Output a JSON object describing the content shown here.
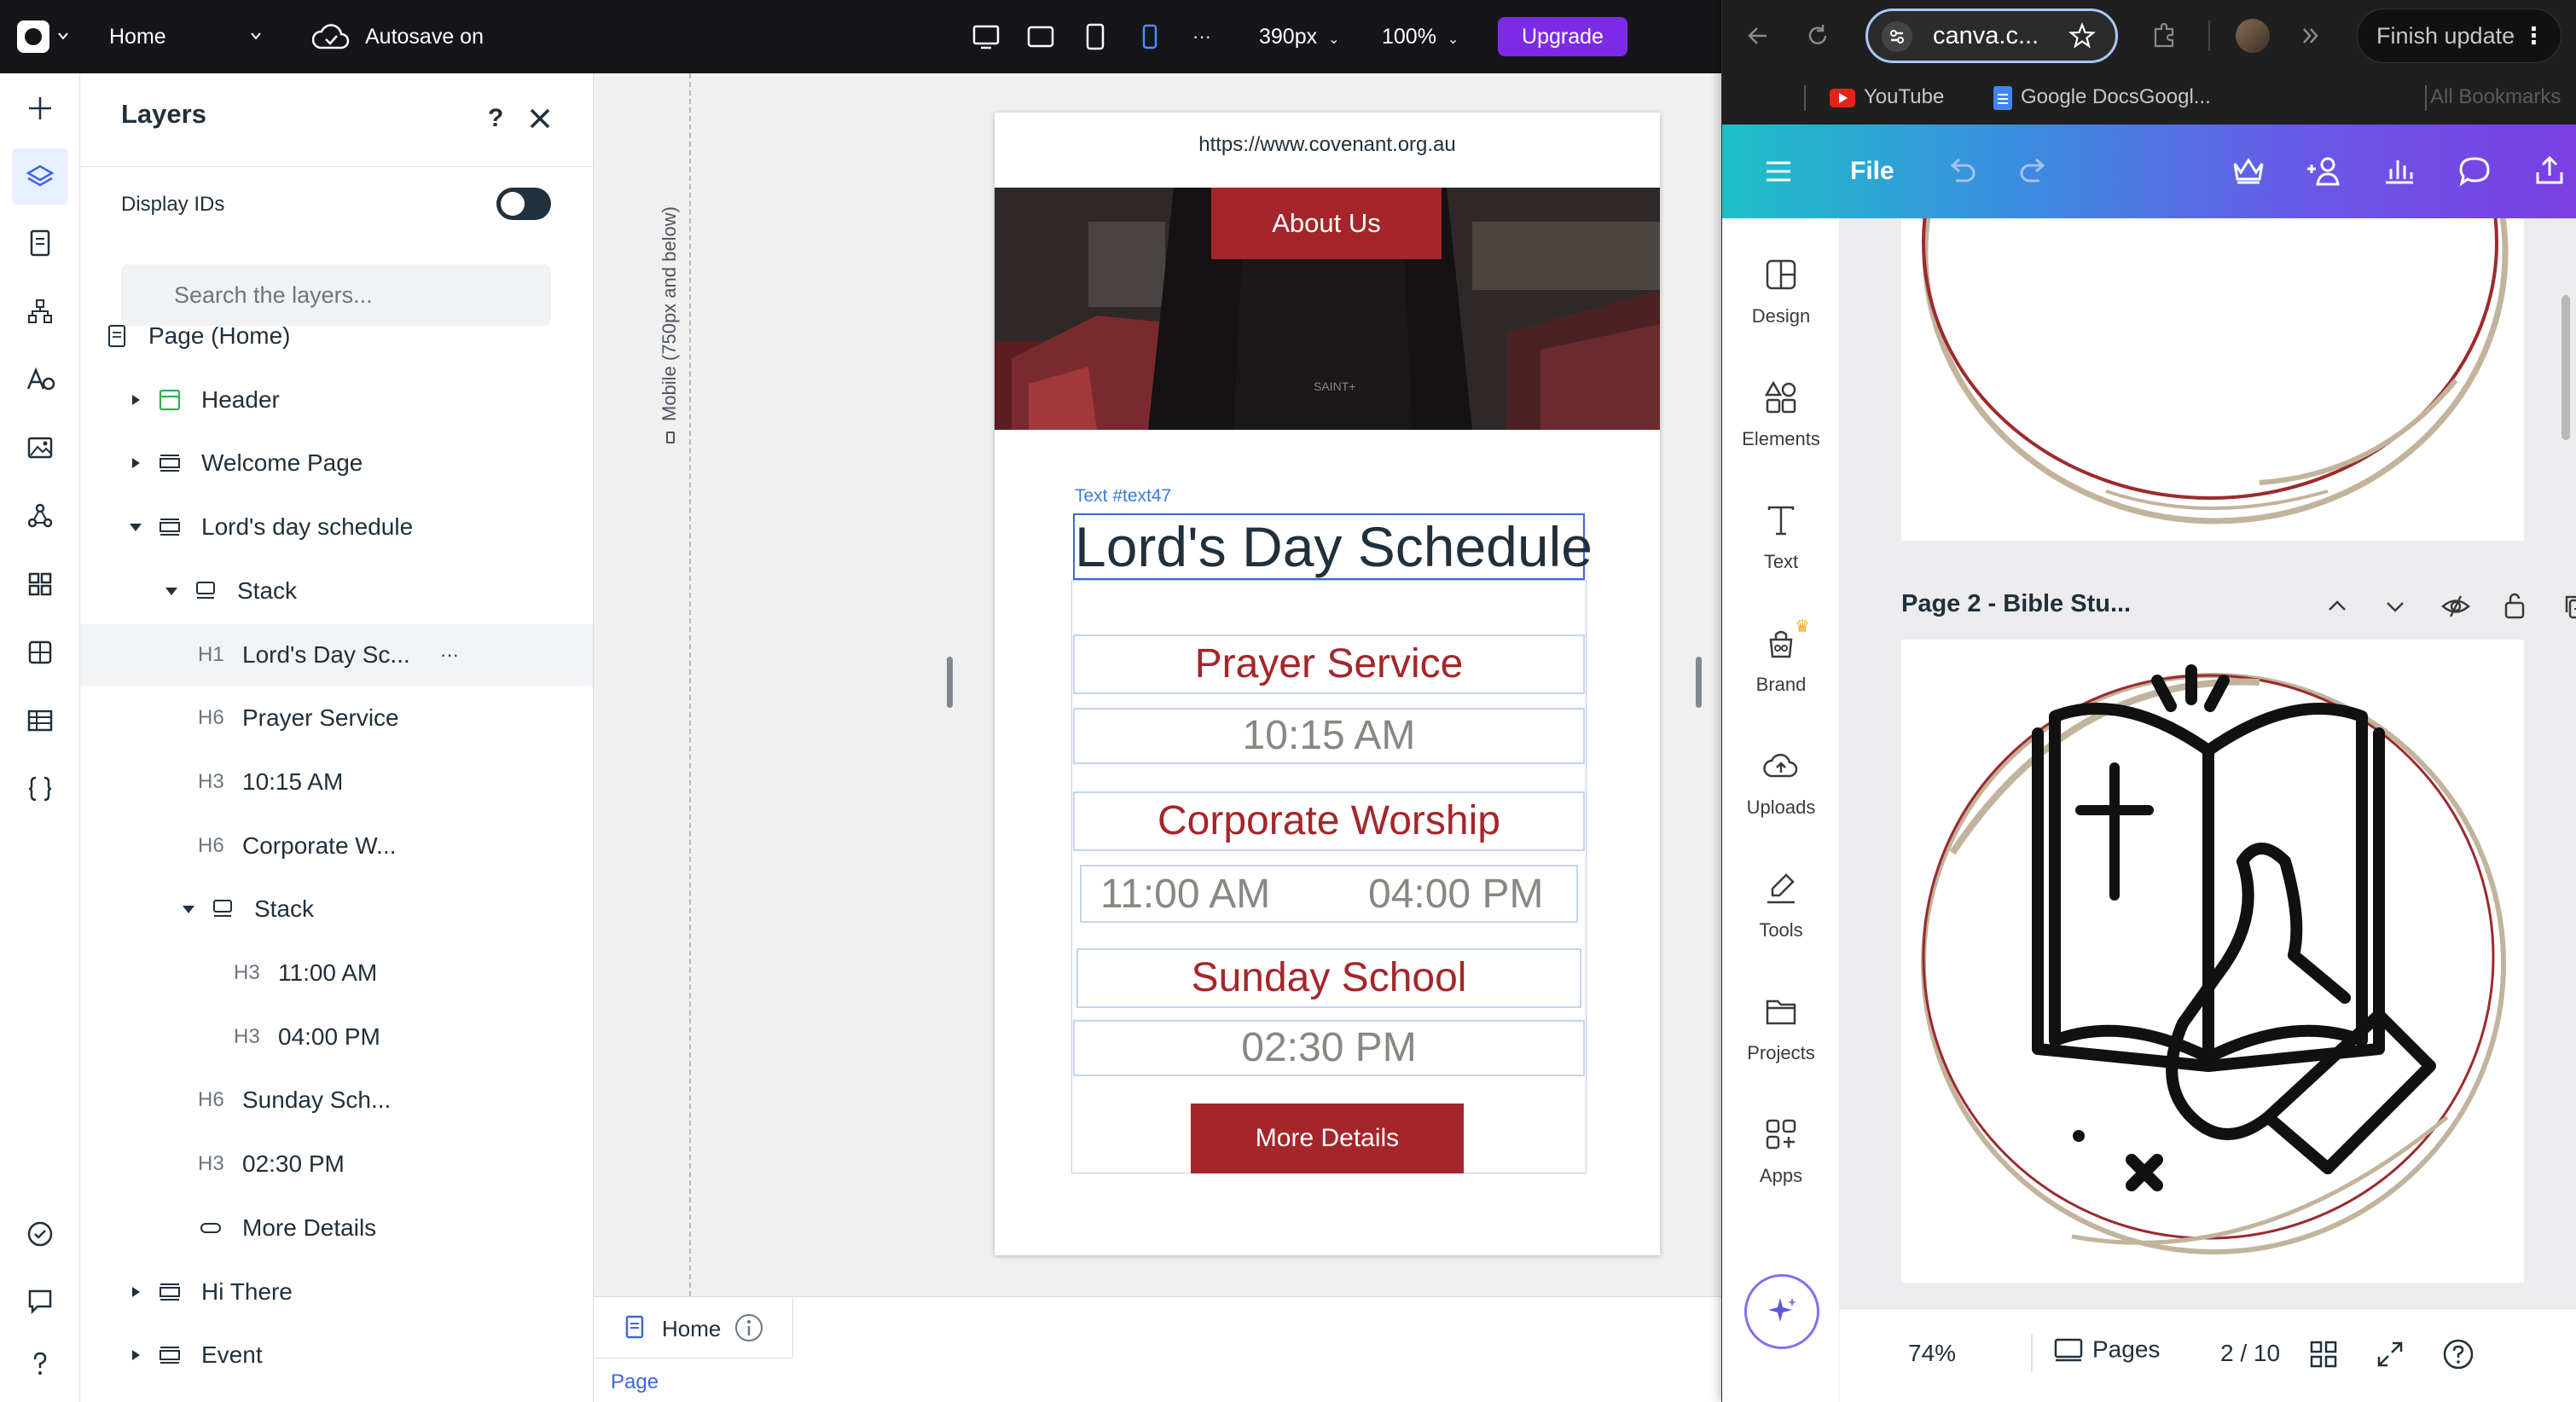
{
  "editor": {
    "page_selector": "Home",
    "autosave": "Autosave on",
    "width_value": "390px",
    "zoom_value": "100%",
    "upgrade_label": "Upgrade",
    "more_glyph": "···"
  },
  "layers_panel": {
    "title": "Layers",
    "help_glyph": "?",
    "display_ids_label": "Display IDs",
    "search_placeholder": "Search the layers...",
    "tree": [
      {
        "tag": "",
        "label": "Page (Home)"
      },
      {
        "tag": "",
        "label": "Header"
      },
      {
        "tag": "",
        "label": "Welcome Page"
      },
      {
        "tag": "",
        "label": "Lord's day schedule"
      },
      {
        "tag": "",
        "label": "Stack"
      },
      {
        "tag": "H1",
        "label": "Lord's Day Sc..."
      },
      {
        "tag": "H6",
        "label": "Prayer Service"
      },
      {
        "tag": "H3",
        "label": "10:15 AM"
      },
      {
        "tag": "H6",
        "label": "Corporate W..."
      },
      {
        "tag": "",
        "label": "Stack"
      },
      {
        "tag": "H3",
        "label": "11:00 AM"
      },
      {
        "tag": "H3",
        "label": "04:00 PM"
      },
      {
        "tag": "H6",
        "label": "Sunday Sch..."
      },
      {
        "tag": "H3",
        "label": "02:30 PM"
      },
      {
        "tag": "",
        "label": "More Details"
      },
      {
        "tag": "",
        "label": "Hi There"
      },
      {
        "tag": "",
        "label": "Event"
      }
    ],
    "row_more_glyph": "···"
  },
  "canvas": {
    "breakpoint_label": "Mobile (750px and below)",
    "url": "https://www.covenant.org.au",
    "about_button": "About Us",
    "text_id_label": "Text #text47",
    "heading": "Lord's Day Schedule",
    "prayer_service": "Prayer Service",
    "prayer_time": "10:15 AM",
    "corporate_worship": "Corporate Worship",
    "worship_time_1": "11:00 AM",
    "worship_time_2": "04:00 PM",
    "sunday_school": "Sunday School",
    "sunday_time": "02:30 PM",
    "more_details": "More Details",
    "shirt_text": "SAINT+"
  },
  "bottom_bar": {
    "home_tab": "Home",
    "page_label": "Page"
  },
  "browser": {
    "omnibox_text": "canva.c...",
    "finish_update": "Finish update",
    "bookmarks": [
      "YouTube",
      "Google DocsGoogl..."
    ],
    "all_bookmarks": "All Bookmarks"
  },
  "canva": {
    "file_label": "File",
    "sidebar": [
      "Design",
      "Elements",
      "Text",
      "Brand",
      "Uploads",
      "Tools",
      "Projects",
      "Apps"
    ],
    "page2_title": "Page 2 - Bible Stu...",
    "zoom": "74%",
    "pages_label": "Pages",
    "page_counter": "2 / 10"
  },
  "colors": {
    "brand_red": "#a4262a",
    "upgrade_purple": "#7d2ae8",
    "selection_blue": "#3b68d9"
  }
}
